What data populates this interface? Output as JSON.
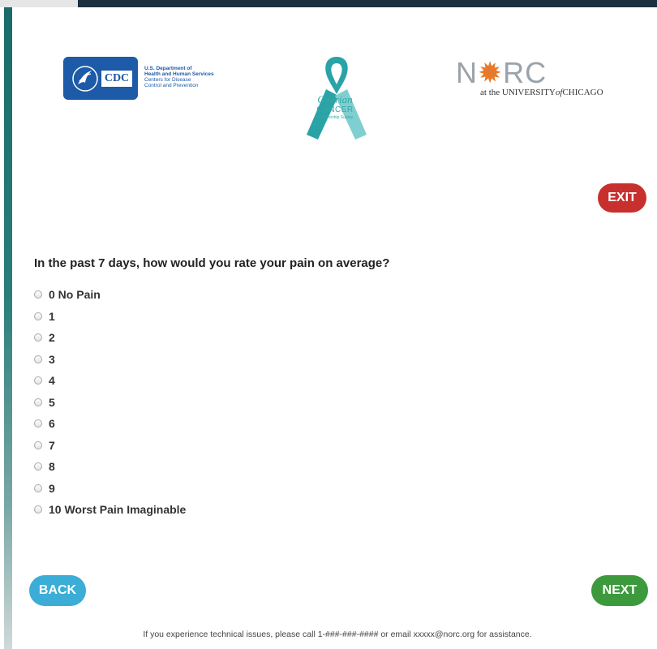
{
  "header": {
    "cdc_mark": "CDC",
    "hhs_lines": [
      "U.S. Department of",
      "Health and Human Services",
      "Centers for Disease",
      "Control and Prevention"
    ],
    "ribbon_title": "Ovarian",
    "ribbon_subtitle": "CANCER",
    "ribbon_caption": "Survivorship Survey",
    "norc_letters_left": "N",
    "norc_letters_right": "RC",
    "norc_sub_pre": "at the UNIVERSITY",
    "norc_sub_of": "of",
    "norc_sub_post": "CHICAGO"
  },
  "buttons": {
    "exit": "EXIT",
    "back": "BACK",
    "next": "NEXT"
  },
  "question": {
    "text": "In the past 7 days, how would you rate your pain on average?",
    "options": [
      "0 No Pain",
      "1",
      "2",
      "3",
      "4",
      "5",
      "6",
      "7",
      "8",
      "9",
      "10 Worst Pain Imaginable"
    ]
  },
  "footer": {
    "text": "If you experience technical issues, please call 1-###-###-#### or email xxxxx@norc.org for assistance."
  },
  "colors": {
    "exit": "#c8302e",
    "back": "#3badd6",
    "next": "#3c9a3c",
    "cdc_blue": "#1d5aa8",
    "ribbon_teal": "#36a6a6",
    "norc_orange": "#e7792b"
  }
}
